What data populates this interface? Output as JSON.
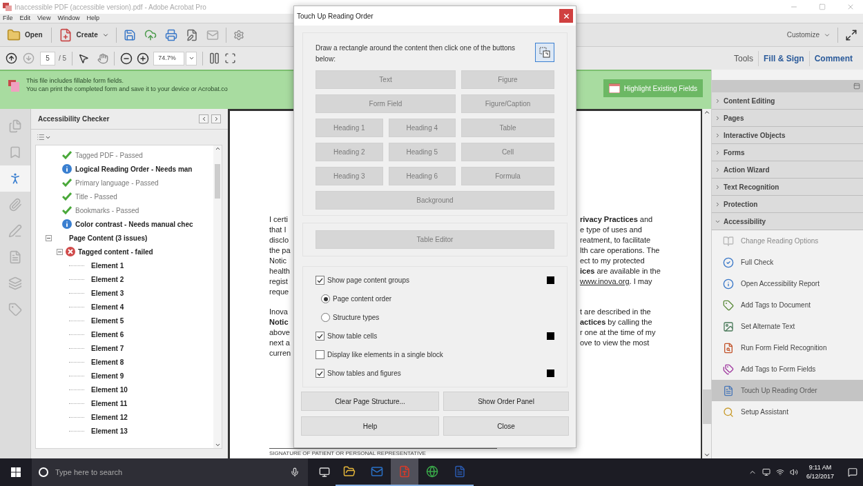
{
  "window": {
    "title": "Inaccessible PDF (accessible version).pdf - Adobe Acrobat Pro"
  },
  "menu": [
    "File",
    "Edit",
    "View",
    "Window",
    "Help"
  ],
  "toolbar": {
    "open": "Open",
    "create": "Create",
    "customize": "Customize",
    "page": "5",
    "page_count": "/ 5",
    "zoom": "74.7%"
  },
  "tool_tabs": [
    {
      "label": "Tools",
      "highlighted": false
    },
    {
      "label": "Fill & Sign",
      "highlighted": true
    },
    {
      "label": "Comment",
      "highlighted": true
    }
  ],
  "form_bar": {
    "lines": [
      "This file includes fillable form fields.",
      "You can print the completed form and save it to your device or Acrobat.co"
    ],
    "button": "Highlight Existing Fields"
  },
  "nav_rail": [
    {
      "selected": false
    },
    {
      "selected": false
    },
    {
      "selected": true
    },
    {
      "selected": false
    },
    {
      "selected": false
    },
    {
      "selected": false
    },
    {
      "selected": false
    },
    {
      "selected": false
    }
  ],
  "checker": {
    "title": "Accessibility Checker",
    "tree": [
      {
        "kind": "continued",
        "children": [
          {
            "label": "Tagged PDF - Passed",
            "kind": "pass"
          },
          {
            "label": "Logical Reading Order - Needs man",
            "kind": "info"
          },
          {
            "label": "Primary language - Passed",
            "kind": "pass"
          },
          {
            "label": "Title - Passed",
            "kind": "pass"
          },
          {
            "label": "Bookmarks - Passed",
            "kind": "pass"
          },
          {
            "label": "Color contrast - Needs manual chec",
            "kind": "info"
          }
        ]
      },
      {
        "kind": "node",
        "label": "Page Content (3 issues)",
        "expanded": true,
        "children": [
          {
            "label": "Tagged content - failed",
            "kind": "fail",
            "expanded": true,
            "children": [
              {
                "label": "Element 1"
              },
              {
                "label": "Element 2"
              },
              {
                "label": "Element 3"
              },
              {
                "label": "Element 4"
              },
              {
                "label": "Element 5"
              },
              {
                "label": "Element 6"
              },
              {
                "label": "Element 7"
              },
              {
                "label": "Element 8"
              },
              {
                "label": "Element 9"
              },
              {
                "label": "Element 10"
              },
              {
                "label": "Element 11"
              },
              {
                "label": "Element 12"
              },
              {
                "label": "Element 13"
              }
            ]
          }
        ]
      }
    ]
  },
  "document": {
    "paragraphs": [
      [
        {
          "left": "I certi",
          "right": "**rivacy Practices** and"
        },
        {
          "left": "that I",
          "right": "e type of uses and"
        },
        {
          "left": "disclo",
          "right": "reatment, to facilitate"
        },
        {
          "left": "the pa",
          "right": "lth care operations. The"
        },
        {
          "left": "Notic",
          "right": "ect to my protected"
        },
        {
          "left": "health",
          "right": "**ices** are available in the"
        },
        {
          "left": "regist",
          "link": "www.inova.org",
          "right": ". I may"
        },
        {
          "left": "reque"
        }
      ],
      [
        {
          "left": "Inova",
          "right": "t are described in the"
        },
        {
          "left": "Notic",
          "left_bold": true,
          "right": "**actices** by calling the"
        },
        {
          "left": "above",
          "right": "r one at the time of my"
        },
        {
          "left": "next a",
          "right": "ove to view the most"
        },
        {
          "left": "curren"
        }
      ]
    ],
    "signature": "SIGNATURE OF PATIENT OR PERSONAL REPRESENTATIVE"
  },
  "dialog": {
    "title": "Touch Up Reading Order",
    "instructions": "Draw a rectangle around the content then click one of the buttons below:",
    "tag_rows": [
      [
        {
          "label": "Text",
          "disabled": true
        },
        {
          "label": "Figure",
          "disabled": true
        }
      ],
      [
        {
          "label": "Form Field",
          "disabled": true
        },
        {
          "label": "Figure/Caption",
          "disabled": true
        }
      ],
      [
        {
          "label": "Heading 1",
          "disabled": true
        },
        {
          "label": "Heading 4",
          "disabled": true
        },
        {
          "label": "Table",
          "disabled": true
        }
      ],
      [
        {
          "label": "Heading 2",
          "disabled": true
        },
        {
          "label": "Heading 5",
          "disabled": true
        },
        {
          "label": "Cell",
          "disabled": true
        }
      ],
      [
        {
          "label": "Heading 3",
          "disabled": true
        },
        {
          "label": "Heading 6",
          "disabled": true
        },
        {
          "label": "Formula",
          "disabled": true
        }
      ],
      [
        {
          "label": "Background",
          "disabled": true
        }
      ]
    ],
    "table_editor": {
      "label": "Table Editor",
      "disabled": true
    },
    "options": [
      {
        "kind": "checkbox",
        "label": "Show page content groups",
        "checked": true,
        "color": "#000000"
      },
      {
        "kind": "radio",
        "label": "Page content order",
        "selected": true
      },
      {
        "kind": "radio",
        "label": "Structure types",
        "selected": false
      },
      {
        "kind": "checkbox",
        "label": "Show table cells",
        "checked": true,
        "color": "#000000"
      },
      {
        "kind": "checkbox",
        "label": "Display like elements in a single block",
        "checked": false
      },
      {
        "kind": "checkbox",
        "label": "Show tables and figures",
        "checked": true,
        "color": "#000000"
      }
    ],
    "buttons": [
      "Clear Page Structure...",
      "Show Order Panel",
      "Help",
      "Close"
    ]
  },
  "tasks_panel": {
    "sections": [
      {
        "label": "Content Editing",
        "expanded": false
      },
      {
        "label": "Pages",
        "expanded": false
      },
      {
        "label": "Interactive Objects",
        "expanded": false
      },
      {
        "label": "Forms",
        "expanded": false
      },
      {
        "label": "Action Wizard",
        "expanded": false
      },
      {
        "label": "Text Recognition",
        "expanded": false
      },
      {
        "label": "Protection",
        "expanded": false
      },
      {
        "label": "Accessibility",
        "expanded": true,
        "items": [
          {
            "label": "Change Reading Options",
            "disabled": true,
            "selected": false
          },
          {
            "label": "Full Check",
            "disabled": false,
            "selected": false
          },
          {
            "label": "Open Accessibility Report",
            "disabled": false,
            "selected": false
          },
          {
            "label": "Add Tags to Document",
            "disabled": false,
            "selected": false
          },
          {
            "label": "Set Alternate Text",
            "disabled": false,
            "selected": false
          },
          {
            "label": "Run Form Field Recognition",
            "disabled": false,
            "selected": false
          },
          {
            "label": "Add Tags to Form Fields",
            "disabled": false,
            "selected": false
          },
          {
            "label": "Touch Up Reading Order",
            "disabled": false,
            "selected": true
          },
          {
            "label": "Setup Assistant",
            "disabled": false,
            "selected": false
          }
        ]
      }
    ]
  },
  "taskbar": {
    "search_placeholder": "Type here to search",
    "apps": [
      {
        "active": false
      },
      {
        "active": false
      },
      {
        "active": true
      },
      {
        "active": false
      },
      {
        "active": false
      }
    ],
    "time": "9:11 AM",
    "date": "6/12/2017"
  }
}
